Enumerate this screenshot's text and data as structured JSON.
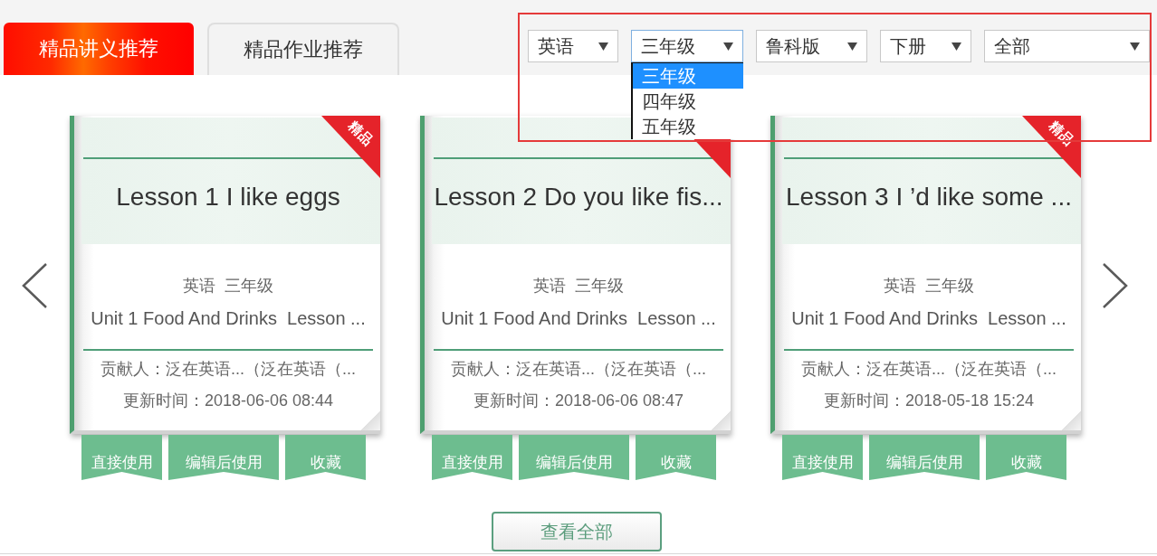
{
  "tabs": [
    {
      "label": "精品讲义推荐",
      "selected": true
    },
    {
      "label": "精品作业推荐",
      "selected": false
    }
  ],
  "filters": [
    {
      "value": "英语",
      "expanded": false
    },
    {
      "value": "三年级",
      "expanded": true,
      "options": [
        {
          "label": "三年级",
          "selected": true
        },
        {
          "label": "四年级",
          "selected": false
        },
        {
          "label": "五年级",
          "selected": false
        }
      ]
    },
    {
      "value": "鲁科版",
      "expanded": false
    },
    {
      "value": "下册",
      "expanded": false
    },
    {
      "value": "全部",
      "expanded": false
    }
  ],
  "cards": [
    {
      "badge": "精品",
      "title": "Lesson 1 I like eggs",
      "meta": "英语  三年级",
      "unit": "Unit 1 Food And Drinks  Lesson ...",
      "contributor": "贡献人：泛在英语...（泛在英语（...",
      "updated": "更新时间：2018-06-06 08:44",
      "actions": [
        "直接使用",
        "编辑后使用",
        "收藏"
      ]
    },
    {
      "title": "Lesson 2 Do you like fis...",
      "meta": "英语  三年级",
      "unit": "Unit 1 Food And Drinks  Lesson ...",
      "contributor": "贡献人：泛在英语...（泛在英语（...",
      "updated": "更新时间：2018-06-06 08:47",
      "actions": [
        "直接使用",
        "编辑后使用",
        "收藏"
      ]
    },
    {
      "badge": "精品",
      "title": "Lesson 3 I ’d like some ...",
      "meta": "英语  三年级",
      "unit": "Unit 1 Food And Drinks  Lesson ...",
      "contributor": "贡献人：泛在英语...（泛在英语（...",
      "updated": "更新时间：2018-05-18 15:24",
      "actions": [
        "直接使用",
        "编辑后使用",
        "收藏"
      ]
    }
  ],
  "view_all_button": "查看全部"
}
